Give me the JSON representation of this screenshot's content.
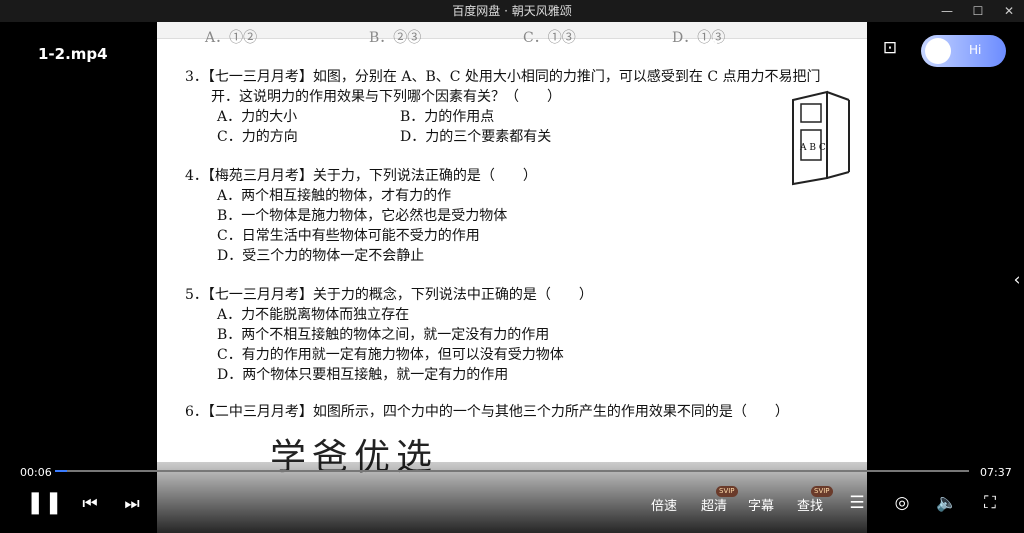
{
  "window": {
    "title": "百度网盘 · 朝天风雅颂",
    "minimize": "—",
    "maximize": "☐",
    "close": "✕"
  },
  "video": {
    "filename": "1-2.mp4",
    "current_time": "00:06",
    "total_time": "07:37",
    "progress": 0.013
  },
  "controls": {
    "speed": "倍速",
    "quality": "超清",
    "subtitles": "字幕",
    "search": "查找",
    "svip": "SVIP",
    "assistant": "Hi"
  },
  "document": {
    "top_options": {
      "a": "A．①②",
      "b": "B．②③",
      "c": "C．①③",
      "d": "D．①③"
    },
    "q3": {
      "line1": "3．【七一三月月考】如图，分别在 A、B、C 处用大小相同的力推门，可以感受到在 C 点用力不易把门",
      "line2": "开．这说明力的作用效果与下列哪个因素有关？（　　）",
      "a": "A．力的大小",
      "b": "B．力的作用点",
      "c": "C．力的方向",
      "d": "D．力的三个要素都有关"
    },
    "q4": {
      "line1": "4．【梅苑三月月考】关于力，下列说法正确的是（　　）",
      "a": "A．两个相互接触的物体，才有力的作",
      "b": "B．一个物体是施力物体，它必然也是受力物体",
      "c": "C．日常生活中有些物体可能不受力的作用",
      "d": "D．受三个力的物体一定不会静止"
    },
    "q5": {
      "line1": "5．【七一三月月考】关于力的概念，下列说法中正确的是（　　）",
      "a": "A．力不能脱离物体而独立存在",
      "b": "B．两个不相互接触的物体之间，就一定没有力的作用",
      "c": "C．有力的作用就一定有施力物体，但可以没有受力物体",
      "d": "D．两个物体只要相互接触，就一定有力的作用"
    },
    "q6": {
      "line1": "6．【二中三月月考】如图所示，四个力中的一个与其他三个力所产生的作用效果不同的是（　　）"
    },
    "door_labels": "A B C",
    "watermark": "学爸优选"
  }
}
